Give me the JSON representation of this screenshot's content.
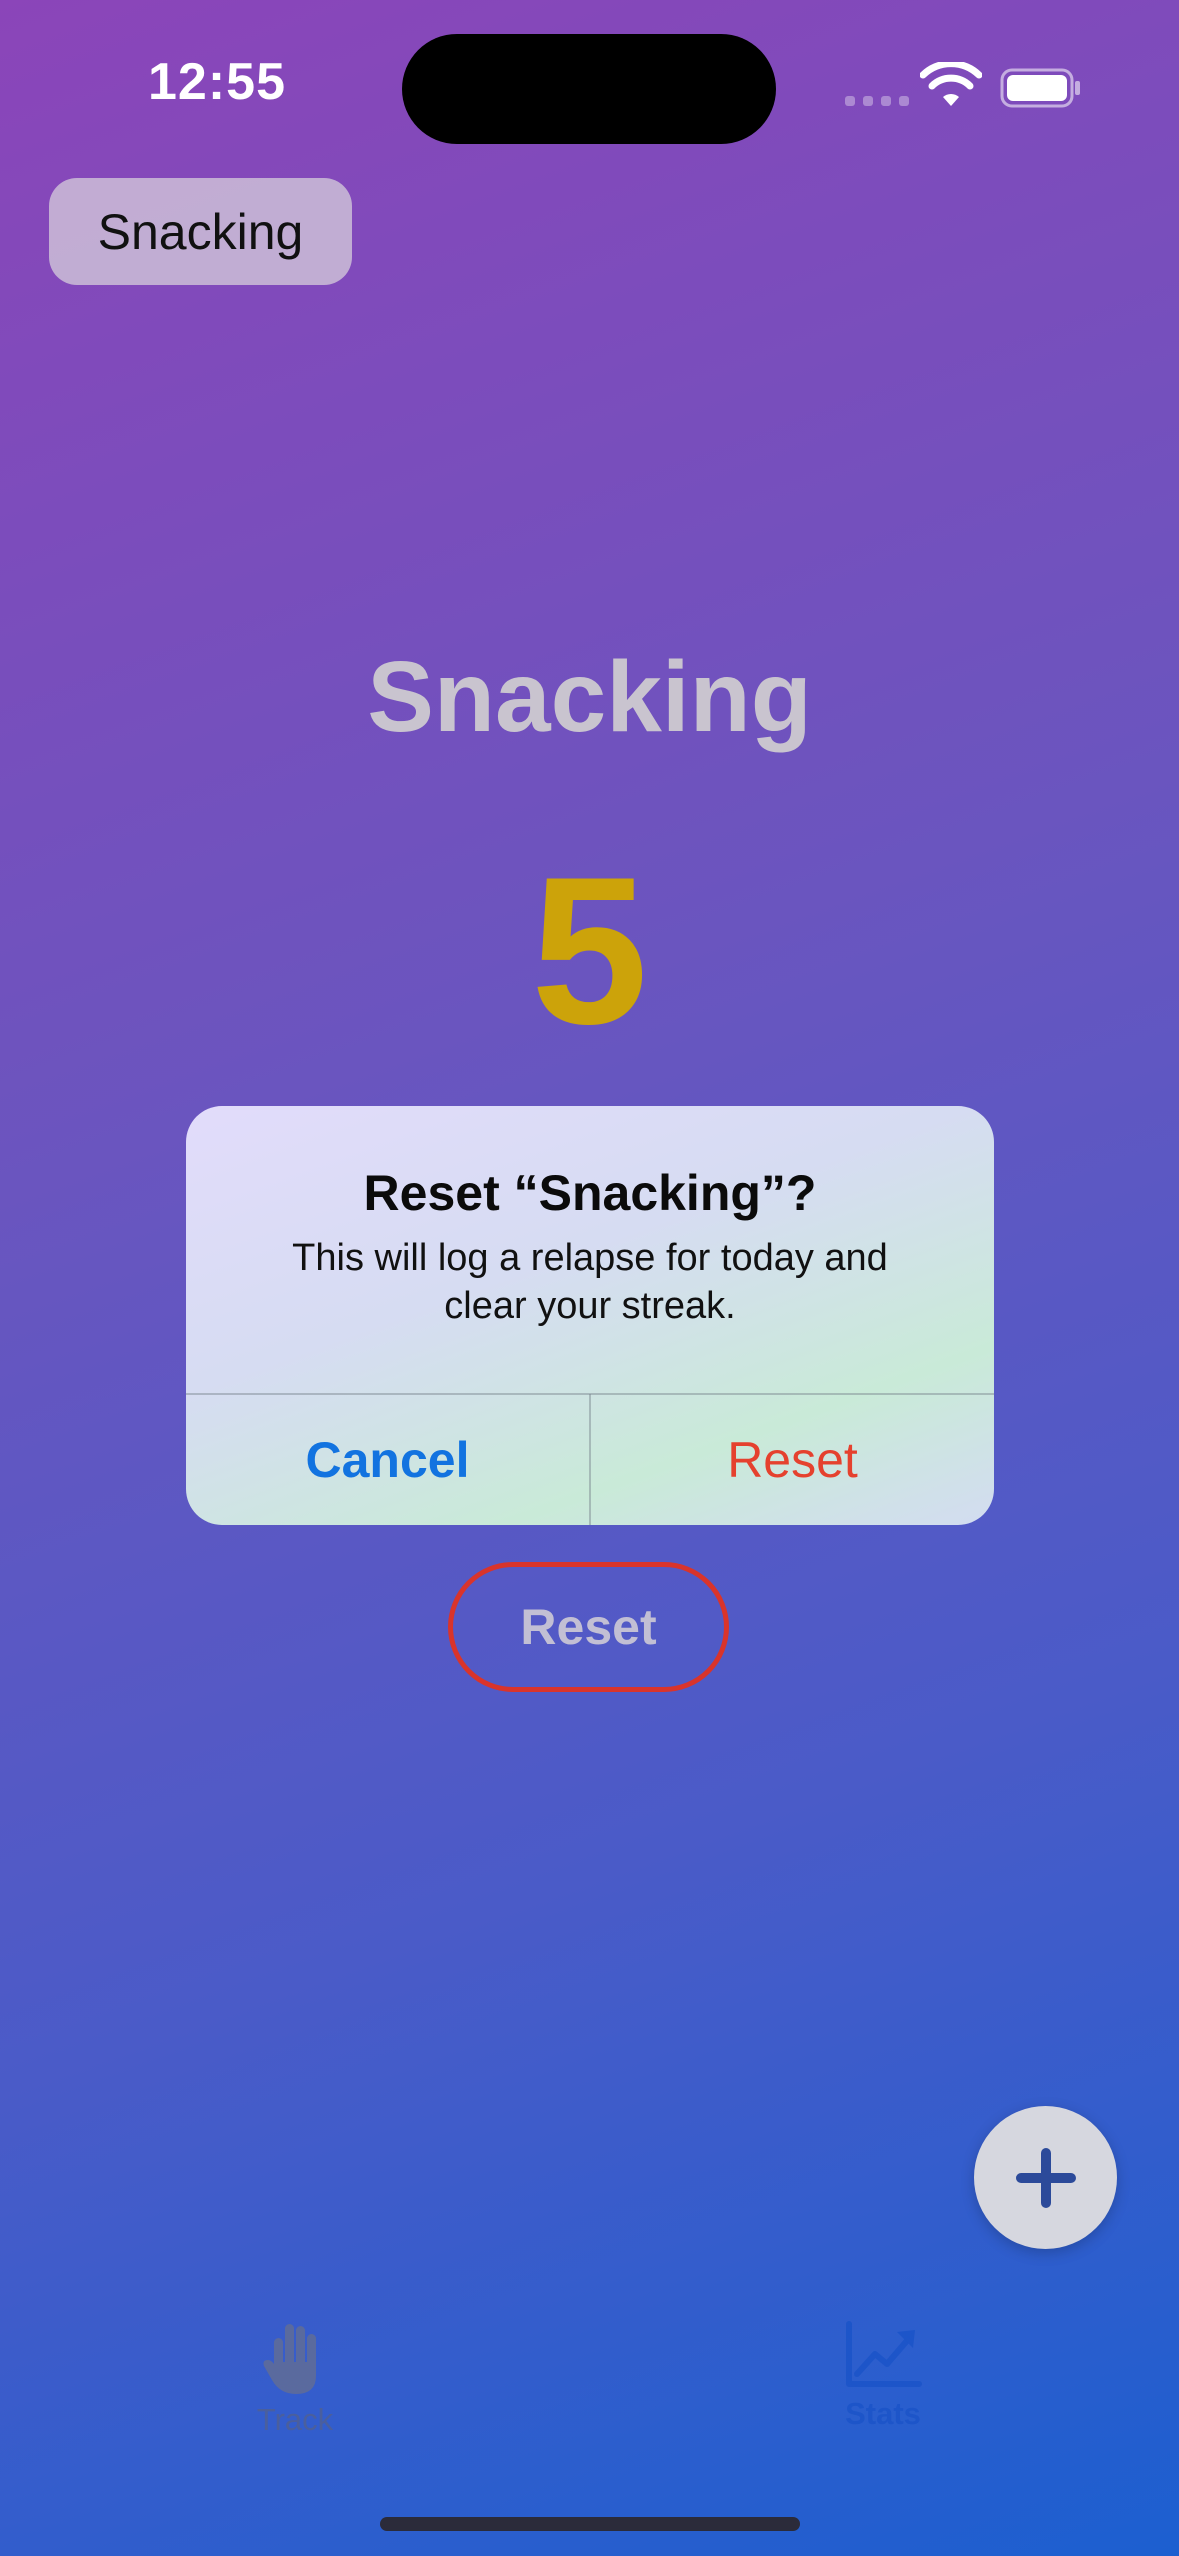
{
  "status_bar": {
    "time": "12:55"
  },
  "habit_chip": {
    "label": "Snacking"
  },
  "main": {
    "title": "Snacking",
    "count": "5",
    "reset_label": "Reset"
  },
  "alert": {
    "title": "Reset “Snacking”?",
    "message": "This will log a relapse for today and clear your streak.",
    "cancel_label": "Cancel",
    "confirm_label": "Reset"
  },
  "tabs": [
    {
      "label": "Track",
      "icon": "hand-icon",
      "selected": false
    },
    {
      "label": "Stats",
      "icon": "chart-icon",
      "selected": true
    }
  ],
  "colors": {
    "counter": "#cca30a",
    "cancel": "#1273e0",
    "destructive": "#e5412e",
    "active_tab": "#1d55c9"
  }
}
